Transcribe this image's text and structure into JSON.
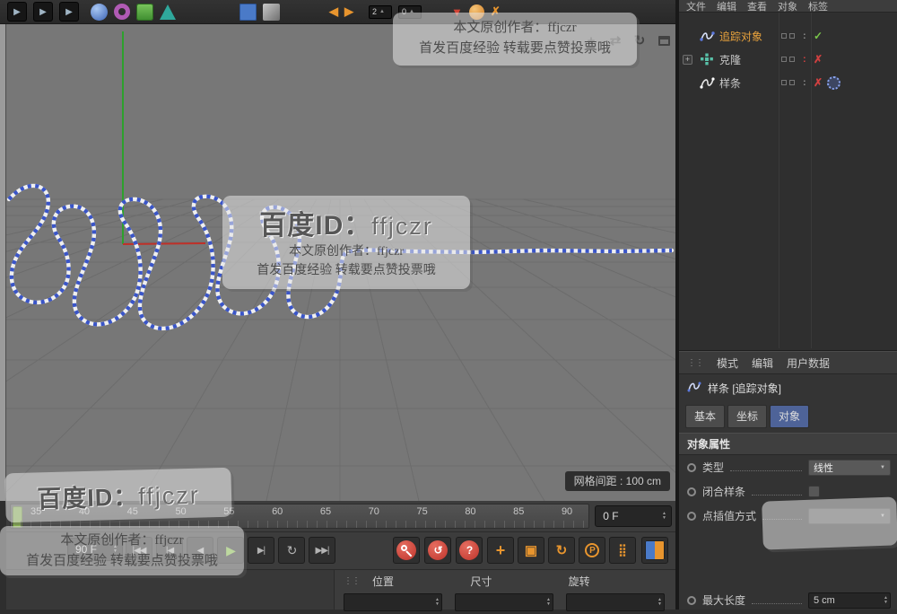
{
  "colors": {
    "accent_orange": "#e8952e",
    "record_red": "#c8403a",
    "play_green": "#8cc84b",
    "spline_blue": "#3a55c8",
    "axis_green": "#2da12d",
    "axis_red": "#c03028",
    "active_tab_blue": "#4e6398",
    "selected_object_orange": "#e8a23c"
  },
  "glyphs": {
    "up": "▲",
    "down": "▼",
    "check": "✓",
    "cross": "✗",
    "dots": ":",
    "handle": "⋮⋮",
    "orbit": "↻",
    "pan": "+",
    "swap": "⇄",
    "play": "▶",
    "expand": "+",
    "dropdown_arrow": "▼",
    "arrow_left": "◀",
    "arrow_right": "▶",
    "arrow_down": "▼",
    "close_x": "✗"
  },
  "toolbar": {
    "field_left": "2",
    "field_right": "0"
  },
  "viewport": {
    "grid_spacing_label": "网格间距 : 100 cm"
  },
  "watermarks": {
    "top": {
      "line1": "本文原创作者：ffjczr",
      "line2": "首发百度经验  转载要点赞投票哦"
    },
    "center": {
      "title_label": "百度ID：",
      "title_name": "ffjczr",
      "line1": "本文原创作者：ffjczr",
      "line2": "首发百度经验  转载要点赞投票哦"
    },
    "bottom": {
      "title_label": "百度ID：",
      "title_name": "ffjczr",
      "line1": "本文原创作者：ffjczr",
      "line2": "首发百度经验  转载要点赞投票哦"
    }
  },
  "object_manager": {
    "menu": [
      "文件",
      "编辑",
      "查看",
      "对象",
      "标签"
    ],
    "rows": [
      {
        "label": "追踪对象",
        "status": "✓"
      },
      {
        "label": "克隆",
        "status": "✗"
      },
      {
        "label": "样条",
        "status": "✗"
      }
    ]
  },
  "attributes": {
    "mode_tabs": [
      "模式",
      "编辑",
      "用户数据"
    ],
    "object_title": "样条 [追踪对象]",
    "tabs": [
      "基本",
      "坐标",
      "对象"
    ],
    "active_tab": "对象",
    "section_title": "对象属性",
    "rows": [
      {
        "label": "类型",
        "value": "线性"
      },
      {
        "label": "闭合样条",
        "value": ""
      },
      {
        "label": "点插值方式",
        "value": ""
      },
      {
        "label": "最大长度",
        "value": "5 cm"
      }
    ]
  },
  "timeline": {
    "ticks": [
      "35",
      "40",
      "45",
      "50",
      "55",
      "60",
      "65",
      "70",
      "75",
      "80",
      "85",
      "90"
    ],
    "current_frame": "0 F"
  },
  "transport": {
    "end_frame": "90 F",
    "playback": [
      {
        "name": "jump-start",
        "glyph": "|◀◀"
      },
      {
        "name": "prev-key",
        "glyph": "|◀"
      },
      {
        "name": "prev-frame",
        "glyph": "◀"
      },
      {
        "name": "play",
        "glyph": "▶"
      },
      {
        "name": "next-frame",
        "glyph": "▶|"
      },
      {
        "name": "loop",
        "glyph": "↻"
      },
      {
        "name": "jump-end",
        "glyph": "▶▶|"
      }
    ],
    "record": [
      {
        "name": "record-keyframe",
        "glyph": ""
      },
      {
        "name": "autokey",
        "glyph": "↺"
      },
      {
        "name": "help",
        "glyph": "?"
      }
    ],
    "keyframe_toggles": [
      {
        "name": "position",
        "glyph": "+"
      },
      {
        "name": "scale",
        "glyph": "▣"
      },
      {
        "name": "rotation",
        "glyph": "↻"
      },
      {
        "name": "parameter",
        "glyph": "P"
      },
      {
        "name": "pla",
        "glyph": "⣿"
      }
    ]
  },
  "coordinates": {
    "headers": [
      "位置",
      "尺寸",
      "旋转"
    ]
  }
}
